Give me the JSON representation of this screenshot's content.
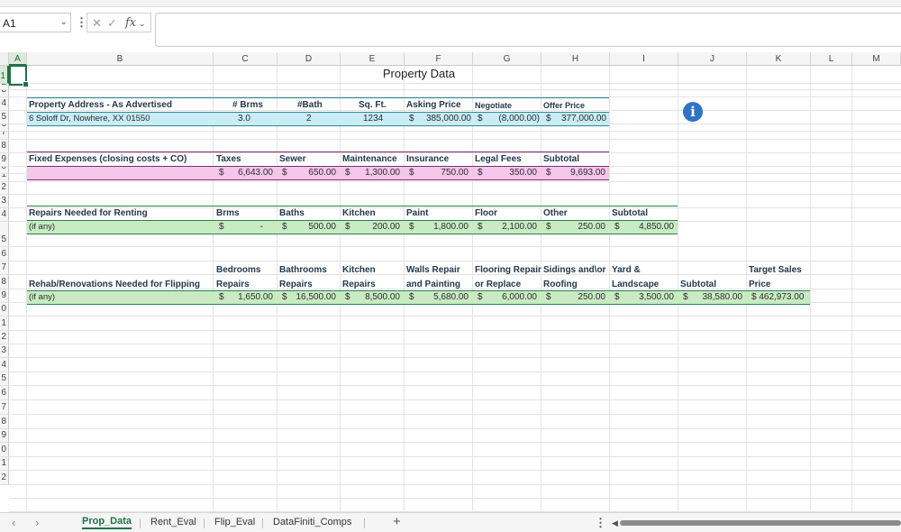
{
  "formula_bar": {
    "name_box": "A1",
    "name_box_dropdown": "⌄",
    "more": "⋮",
    "cancel": "✕",
    "enter": "✓",
    "fx": "fx",
    "fx_dropdown": "⌄",
    "formula": ""
  },
  "columns": [
    "A",
    "B",
    "C",
    "D",
    "E",
    "F",
    "G",
    "H",
    "I",
    "J",
    "K",
    "L",
    "M"
  ],
  "rows": [
    "1",
    "2",
    "3",
    "4",
    "5",
    "6",
    "7",
    "8",
    "9",
    "0",
    "1",
    "2",
    "3",
    "4",
    "5",
    "6",
    "7",
    "8",
    "9",
    "0",
    "1",
    "2",
    "3",
    "4",
    "5",
    "6",
    "7",
    "8",
    "9",
    "0",
    "1",
    "2"
  ],
  "title": "Property Data",
  "section1": {
    "headers": [
      "Property Address - As Advertised",
      "# Brms",
      "#Bath",
      "Sq. Ft.",
      "Asking Price",
      "Negotiate",
      "Offer Price"
    ],
    "values": [
      "6 Soloff Dr, Nowhere, XX 01550",
      "3.0",
      "2",
      "1234",
      "$",
      "385,000.00",
      "$",
      "(8,000.00)",
      "$",
      "377,000.00"
    ]
  },
  "section2": {
    "headers": [
      "Fixed Expenses (closing costs + CO)",
      "Taxes",
      "Sewer",
      "Maintenance",
      "Insurance",
      "Legal Fees",
      "Subtotal"
    ],
    "values": [
      "$",
      "6,643.00",
      "$",
      "650.00",
      "$",
      "1,300.00",
      "$",
      "750.00",
      "$",
      "350.00",
      "$",
      "9,693.00"
    ]
  },
  "section3": {
    "headers": [
      "Repairs Needed for Renting",
      "Brms",
      "Baths",
      "Kitchen",
      "Paint",
      "Floor",
      "Other",
      "Subtotal"
    ],
    "label": "(if any)",
    "values": [
      "$",
      "-",
      "$",
      "500.00",
      "$",
      "200.00",
      "$",
      "1,800.00",
      "$",
      "2,100.00",
      "$",
      "250.00",
      "$",
      "4,850.00"
    ]
  },
  "section4": {
    "headers_line1": [
      "Bedrooms",
      "Bathrooms",
      "Kitchen",
      "Walls Repair",
      "Flooring Repair",
      "Sidings and\\or",
      "Yard &",
      "Target Sales"
    ],
    "headers_line2": [
      "Rehab/Renovations Needed for Flipping",
      "Repairs",
      "Repairs",
      "Repairs",
      "and Painting",
      "or Replace",
      "Roofing",
      "Landscape",
      "Subtotal",
      "Price"
    ],
    "label": "(if any)",
    "values": [
      "$",
      "1,650.00",
      "$",
      "16,500.00",
      "$",
      "8,500.00",
      "$",
      "5,680.00",
      "$",
      "6,000.00",
      "$",
      "250.00",
      "$",
      "3,500.00",
      "$",
      "38,580.00",
      "$ 462,973.00"
    ]
  },
  "info_icon": "i",
  "sheet_tabs": {
    "prev": "‹",
    "next": "›",
    "tabs": [
      "Prop_Data",
      "Rent_Eval",
      "Flip_Eval",
      "DataFiniti_Comps"
    ],
    "active": "Prop_Data",
    "add": "+",
    "more": "⋮",
    "scroll_left": "◀"
  },
  "colors": {
    "accent": "#1e7145",
    "row_blue": "#c9ecf7",
    "row_pink": "#f3c6ea",
    "row_green": "#c8ebc4",
    "line_teal": "#2a8a92",
    "line_purple": "#7d2e6e",
    "line_green": "#2f7f4a",
    "info_blue": "#2e74c6"
  }
}
